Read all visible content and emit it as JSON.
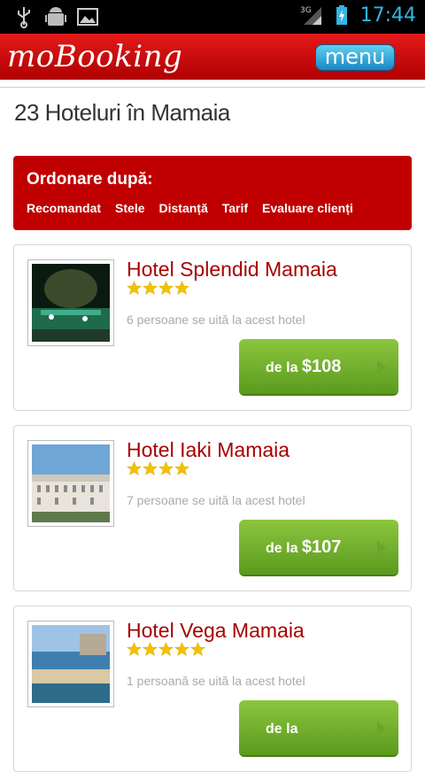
{
  "status": {
    "time": "17:44",
    "network": "3G"
  },
  "app": {
    "logo": "moBooking",
    "menu_label": "menu"
  },
  "page": {
    "title": "23 Hoteluri în Mamaia"
  },
  "sort": {
    "title": "Ordonare după:",
    "options": [
      "Recomandat",
      "Stele",
      "Distanță",
      "Tarif",
      "Evaluare clienți"
    ]
  },
  "hotels": [
    {
      "name": "Hotel Splendid Mamaia",
      "stars": 4,
      "viewers": "6 persoane se uită la acest hotel",
      "price_prefix": "de la ",
      "price": "$108"
    },
    {
      "name": "Hotel Iaki Mamaia",
      "stars": 4,
      "viewers": "7 persoane se uită la acest hotel",
      "price_prefix": "de la ",
      "price": "$107"
    },
    {
      "name": "Hotel Vega Mamaia",
      "stars": 5,
      "viewers": "1 persoană se uită la acest hotel",
      "price_prefix": "de la ",
      "price": ""
    }
  ],
  "colors": {
    "brand_red": "#c00000",
    "price_green": "#7bb832",
    "clock_blue": "#33b5e5"
  }
}
